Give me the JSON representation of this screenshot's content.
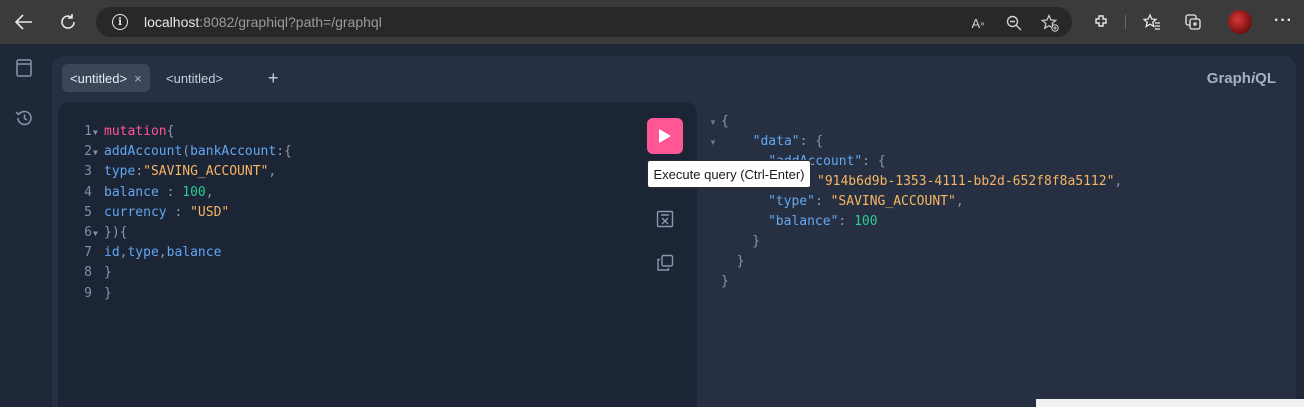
{
  "browser": {
    "url_host": "localhost",
    "url_rest": ":8082/graphiql?path=/graphql"
  },
  "tabs": [
    {
      "label": "<untitled>",
      "close": "×"
    },
    {
      "label": "<untitled>"
    }
  ],
  "add_tab_label": "+",
  "logo": {
    "prefix": "Graph",
    "italic": "i",
    "suffix": "QL"
  },
  "editor": {
    "line_numbers": [
      "1",
      "2",
      "3",
      "4",
      "5",
      "6",
      "7",
      "8",
      "9"
    ],
    "lines": [
      {
        "t": [
          [
            "kw",
            "mutation"
          ],
          [
            "pun",
            "{"
          ]
        ]
      },
      {
        "t": [
          [
            "src",
            "  "
          ],
          [
            "fn",
            "addAccount"
          ],
          [
            "pun",
            "("
          ],
          [
            "arg",
            "bankAccount"
          ],
          [
            "pun",
            ":{"
          ]
        ]
      },
      {
        "t": [
          [
            "src",
            "    "
          ],
          [
            "attr",
            "type"
          ],
          [
            "pun",
            ":"
          ],
          [
            "str",
            "\"SAVING_ACCOUNT\""
          ],
          [
            "pun",
            ","
          ]
        ]
      },
      {
        "t": [
          [
            "src",
            "    "
          ],
          [
            "attr",
            "balance"
          ],
          [
            "pun",
            " : "
          ],
          [
            "num",
            "100"
          ],
          [
            "pun",
            ","
          ]
        ]
      },
      {
        "t": [
          [
            "src",
            "    "
          ],
          [
            "attr",
            "currency"
          ],
          [
            "pun",
            " : "
          ],
          [
            "str",
            "\"USD\""
          ]
        ]
      },
      {
        "t": [
          [
            "src",
            "  "
          ],
          [
            "pun",
            "}){"
          ]
        ]
      },
      {
        "t": [
          [
            "src",
            "    "
          ],
          [
            "attr",
            "id"
          ],
          [
            "pun",
            ","
          ],
          [
            "attr",
            "type"
          ],
          [
            "pun",
            ","
          ],
          [
            "attr",
            "balance"
          ]
        ]
      },
      {
        "t": [
          [
            "src",
            "  "
          ],
          [
            "pun",
            "}"
          ]
        ]
      },
      {
        "t": [
          [
            "pun",
            "}"
          ]
        ]
      }
    ]
  },
  "tooltip": "Execute query (Ctrl-Enter)",
  "result": {
    "lines": [
      {
        "t": [
          [
            "pun",
            "{"
          ]
        ]
      },
      {
        "t": [
          [
            "pun",
            "  "
          ],
          [
            "attr",
            "\"data\""
          ],
          [
            "pun",
            ": {"
          ]
        ]
      },
      {
        "t": [
          [
            "pun",
            "    "
          ],
          [
            "attr",
            "\"addAccount\""
          ],
          [
            "pun",
            ": {"
          ]
        ]
      },
      {
        "t": [
          [
            "str",
            "\"914b6d9b-1353-4111-bb2d-652f8f8a5112\""
          ],
          [
            "pun",
            ","
          ]
        ]
      },
      {
        "t": [
          [
            "pun",
            "      "
          ],
          [
            "attr",
            "\"type\""
          ],
          [
            "pun",
            ": "
          ],
          [
            "str",
            "\"SAVING_ACCOUNT\""
          ],
          [
            "pun",
            ","
          ]
        ]
      },
      {
        "t": [
          [
            "pun",
            "      "
          ],
          [
            "attr",
            "\"balance\""
          ],
          [
            "pun",
            ": "
          ],
          [
            "num",
            "100"
          ]
        ]
      },
      {
        "t": [
          [
            "pun",
            "    }"
          ]
        ]
      },
      {
        "t": [
          [
            "pun",
            "  }"
          ]
        ]
      },
      {
        "t": [
          [
            "pun",
            "}"
          ]
        ]
      }
    ]
  }
}
